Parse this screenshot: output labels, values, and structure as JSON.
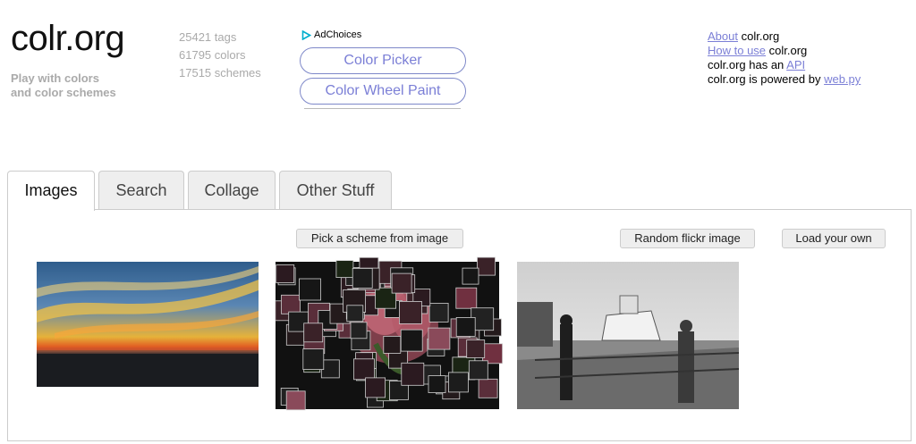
{
  "header": {
    "logo": "colr.org",
    "tagline": [
      "Play with colors",
      "and color schemes"
    ],
    "stats": [
      "25421 tags",
      "61795 colors",
      "17515 schemes"
    ]
  },
  "ad": {
    "adchoices": "AdChoices",
    "buttons": [
      "Color Picker",
      "Color Wheel Paint"
    ]
  },
  "info": {
    "about_link": "About",
    "about_rest": " colr.org",
    "howto_link": "How to use",
    "howto_rest": " colr.org",
    "api_prefix": "colr.org has an ",
    "api_link": "API",
    "powered_prefix": "colr.org is powered by ",
    "powered_link": "web.py"
  },
  "tabs": [
    {
      "label": "Images",
      "active": true
    },
    {
      "label": "Search",
      "active": false
    },
    {
      "label": "Collage",
      "active": false
    },
    {
      "label": "Other Stuff",
      "active": false
    }
  ],
  "panel": {
    "pick_button": "Pick a scheme from image",
    "random_button": "Random flickr image",
    "load_button": "Load your own"
  },
  "colors": {
    "link": "#7b7fd6",
    "pill_border": "#7e88c9",
    "muted_text": "#aaaaaa",
    "tab_bg": "#eeeeee"
  }
}
